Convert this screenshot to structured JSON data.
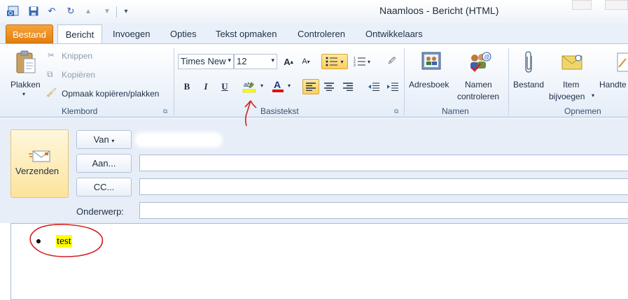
{
  "window": {
    "title": "Naamloos  -  Bericht (HTML)"
  },
  "quick_access": [
    "outlook-icon",
    "save-icon",
    "undo-icon",
    "redo-icon",
    "up-arrow-icon",
    "down-arrow-icon",
    "customize-icon"
  ],
  "tabs": [
    {
      "label": "Bestand"
    },
    {
      "label": "Bericht"
    },
    {
      "label": "Invoegen"
    },
    {
      "label": "Opties"
    },
    {
      "label": "Tekst opmaken"
    },
    {
      "label": "Controleren"
    },
    {
      "label": "Ontwikkelaars"
    }
  ],
  "ribbon": {
    "klembord": {
      "label": "Klembord",
      "plakken": "Plakken",
      "knippen": "Knippen",
      "kopieren": "Kopiëren",
      "opmaak": "Opmaak kopiëren/plakken"
    },
    "basistekst": {
      "label": "Basistekst",
      "font_name": "Times New",
      "font_size": "12",
      "bold": "B",
      "italic": "I",
      "underline": "U",
      "highlight_color": "#ffff00",
      "font_color": "#e01010"
    },
    "namen": {
      "label": "Namen",
      "adresboek": "Adresboek",
      "namen_1": "Namen",
      "namen_2": "controleren"
    },
    "opnemen": {
      "label": "Opnemen",
      "bestand": "Bestand",
      "item_1": "Item",
      "item_2": "bijvoegen",
      "handtekening": "Handte"
    }
  },
  "compose": {
    "send": "Verzenden",
    "van": "Van",
    "aan": "Aan...",
    "cc": "CC...",
    "onderwerp": "Onderwerp:"
  },
  "body": {
    "text": "test"
  },
  "colors": {
    "accent_tab": "#e47f0e",
    "annotation": "#d42020"
  }
}
